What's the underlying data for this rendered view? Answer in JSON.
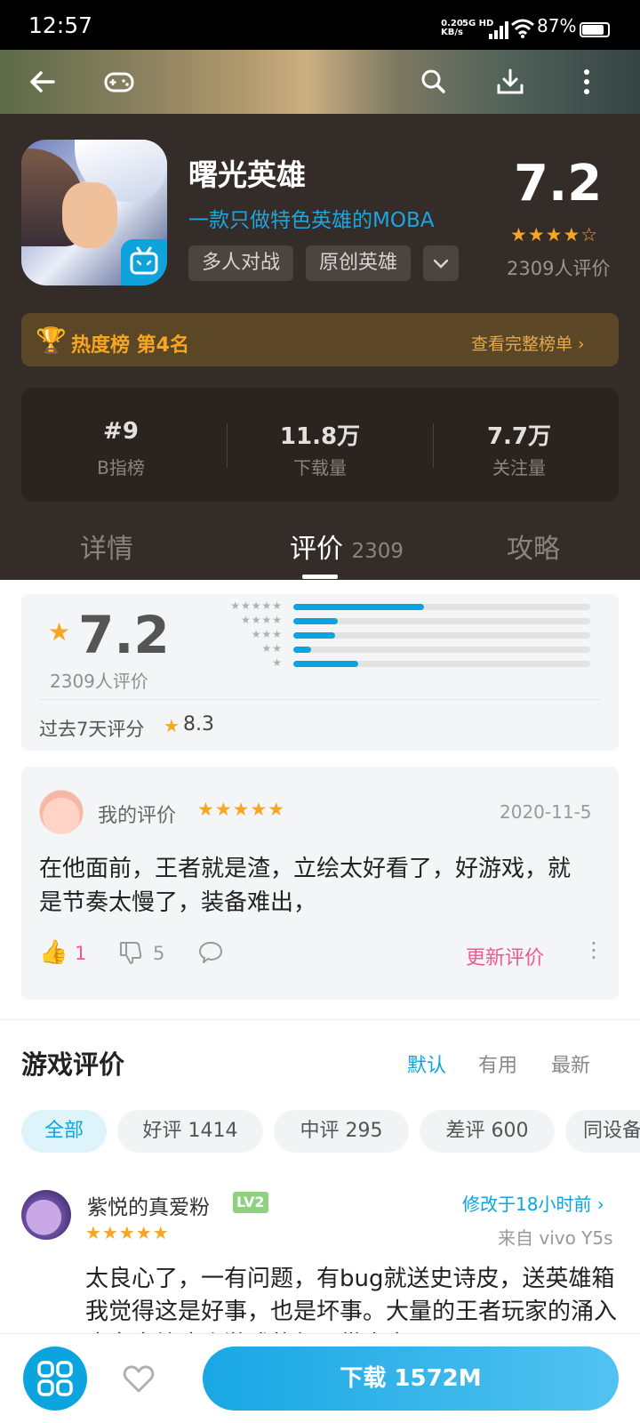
{
  "status_bar": {
    "time": "12:57",
    "net_speed_value": "0.20",
    "net_speed_unit": "KB/s",
    "network": "5G HD",
    "battery_percent": "87%",
    "battery_level": 0.87
  },
  "header": {
    "back_icon": "arrow-left-icon",
    "gamepad_icon": "gamepad-icon",
    "search_icon": "search-icon",
    "download_icon": "download-icon",
    "more_icon": "more-vertical-icon"
  },
  "app": {
    "title": "曙光英雄",
    "subtitle": "一款只做特色英雄的MOBA",
    "tags": [
      "多人对战",
      "原创英雄"
    ],
    "rating": "7.2",
    "rating_stars": "★★★★☆",
    "rating_count": "2309人评价"
  },
  "rank": {
    "label": "热度榜 第4名",
    "link": "查看完整榜单 ›"
  },
  "stats": [
    {
      "value": "#9",
      "label": "B指榜"
    },
    {
      "value": "11.8万",
      "label": "下载量"
    },
    {
      "value": "7.7万",
      "label": "关注量"
    }
  ],
  "tabs": {
    "details": "详情",
    "reviews": "评价",
    "reviews_count": "2309",
    "guides": "攻略"
  },
  "summary": {
    "score": "7.2",
    "count": "2309人评价",
    "distribution": [
      {
        "stars": "★★★★★",
        "fraction": 0.44
      },
      {
        "stars": "★★★★",
        "fraction": 0.15
      },
      {
        "stars": "★★★",
        "fraction": 0.14
      },
      {
        "stars": "★★",
        "fraction": 0.06
      },
      {
        "stars": "★",
        "fraction": 0.22
      }
    ],
    "week_label": "过去7天评分",
    "week_score": "8.3"
  },
  "my_review": {
    "label": "我的评价",
    "stars": "★★★★★",
    "date": "2020-11-5",
    "text": "在他面前，王者就是渣，立绘太好看了，好游戏，就是节奏太慢了，装备难出，",
    "likes": "1",
    "dislikes": "5",
    "update_label": "更新评价"
  },
  "game_reviews": {
    "title": "游戏评价",
    "sort": [
      "默认",
      "有用",
      "最新"
    ],
    "chips": [
      "全部",
      "好评 1414",
      "中评 295",
      "差评 600",
      "同设备"
    ]
  },
  "user_review": {
    "name": "紫悦的真爱粉",
    "level": "LV2",
    "modified": "修改于18小时前 ›",
    "stars": "★★★★★",
    "device": "来自 vivo Y5s",
    "text": "太良心了，一有问题，有bug就送史诗皮，送英雄箱我觉得这是好事，也是坏事。大量的王者玩家的涌入也完全给这个游戏的氛围带来齐"
  },
  "bottom": {
    "download_label": "下载 1572M"
  }
}
